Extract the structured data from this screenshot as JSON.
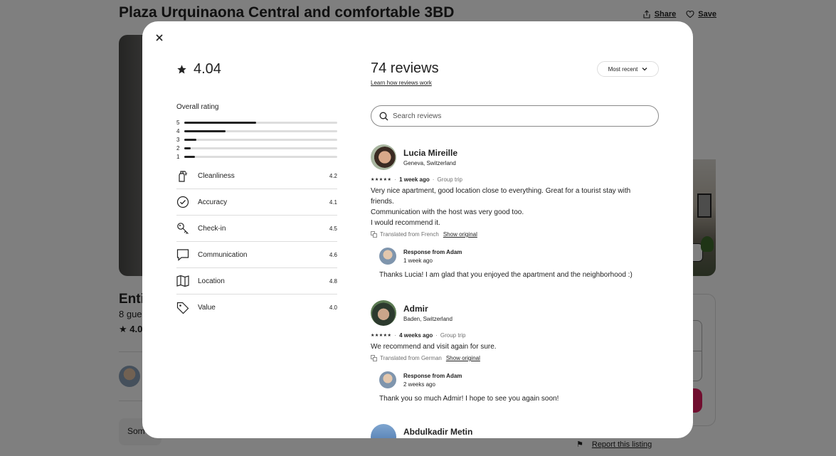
{
  "listing": {
    "title": "Plaza Urquinaona Central and comfortable 3BD",
    "share_label": "Share",
    "save_label": "Save",
    "entire_partial": "Entir",
    "guests_partial": "8 gues",
    "rating_partial": "4.0",
    "some_partial": "Som",
    "report_label": "Report this listing"
  },
  "modal": {
    "overall": {
      "rating": "4.04",
      "label": "Overall rating",
      "distribution": [
        {
          "stars": "5",
          "fraction": 0.47
        },
        {
          "stars": "4",
          "fraction": 0.27
        },
        {
          "stars": "3",
          "fraction": 0.08
        },
        {
          "stars": "2",
          "fraction": 0.04
        },
        {
          "stars": "1",
          "fraction": 0.07
        }
      ]
    },
    "categories": [
      {
        "label": "Cleanliness",
        "score": "4.2",
        "icon": "spray-bottle-icon"
      },
      {
        "label": "Accuracy",
        "score": "4.1",
        "icon": "check-circle-icon"
      },
      {
        "label": "Check-in",
        "score": "4.5",
        "icon": "key-icon"
      },
      {
        "label": "Communication",
        "score": "4.6",
        "icon": "message-icon"
      },
      {
        "label": "Location",
        "score": "4.8",
        "icon": "map-icon"
      },
      {
        "label": "Value",
        "score": "4.0",
        "icon": "tag-icon"
      }
    ],
    "reviews_header": {
      "count_label": "74 reviews",
      "learn_link": "Learn how reviews work",
      "sort_label": "Most recent",
      "search_placeholder": "Search reviews"
    },
    "reviews": [
      {
        "name": "Lucia Mireille",
        "location": "Geneva, Switzerland",
        "stars": "★★★★★",
        "when": "1 week ago",
        "trip": "Group trip",
        "lines": [
          "Very nice apartment, good location close to everything. Great for a tourist stay with",
          "friends.",
          "Communication with the host was very good too.",
          "I would recommend it."
        ],
        "translated": "Translated from French",
        "show_original": "Show original",
        "response": {
          "by": "Response from Adam",
          "when": "1 week ago",
          "text": "Thanks Lucia! I am glad that you enjoyed the apartment and the neighborhood :)"
        }
      },
      {
        "name": "Admir",
        "location": "Baden, Switzerland",
        "stars": "★★★★★",
        "when": "4 weeks ago",
        "trip": "Group trip",
        "lines": [
          "We recommend and visit again for sure."
        ],
        "translated": "Translated from German",
        "show_original": "Show original",
        "response": {
          "by": "Response from Adam",
          "when": "2 weeks ago",
          "text": "Thank you so much Admir! I hope to see you again soon!"
        }
      },
      {
        "name": "Abdulkadir Metin"
      }
    ]
  },
  "colors": {
    "overlay": "rgba(0,0,0,0.5)",
    "text": "#222222",
    "muted": "#717171",
    "divider": "#dddddd",
    "brand": "#e31c5f"
  }
}
